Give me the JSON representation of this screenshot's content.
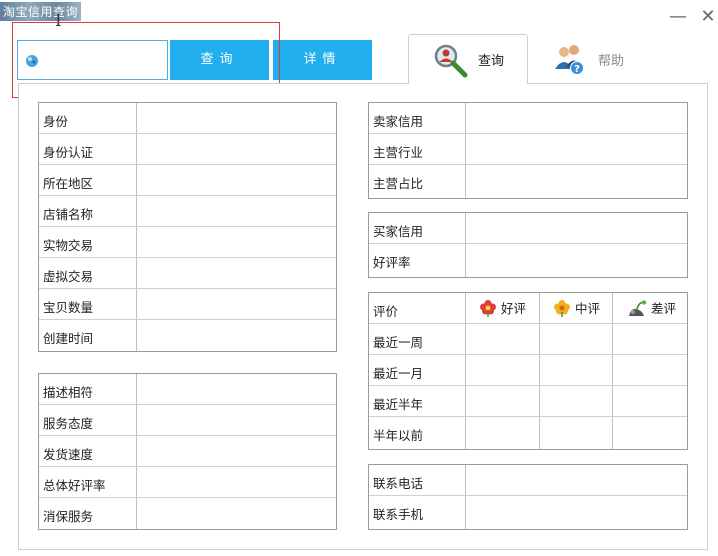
{
  "window": {
    "title": "淘宝信用查询",
    "min": "—",
    "close": "✕"
  },
  "search": {
    "value": "",
    "placeholder": ""
  },
  "buttons": {
    "query": "查询",
    "detail": "详情"
  },
  "tabs": [
    {
      "label": "查询",
      "icon": "magnifier-person-icon",
      "active": true
    },
    {
      "label": "帮助",
      "icon": "users-help-icon",
      "active": false
    }
  ],
  "info_group": {
    "rows": [
      "身份",
      "身份认证",
      "所在地区",
      "店铺名称",
      "实物交易",
      "虚拟交易",
      "宝贝数量",
      "创建时间"
    ]
  },
  "service_group": {
    "rows": [
      "描述相符",
      "服务态度",
      "发货速度",
      "总体好评率",
      "消保服务"
    ]
  },
  "seller_group": {
    "rows": [
      "卖家信用",
      "主营行业",
      "主营占比"
    ]
  },
  "buyer_group": {
    "rows": [
      "买家信用",
      "好评率"
    ]
  },
  "rating_group": {
    "header": {
      "label": "评价",
      "good": "好评",
      "neutral": "中评",
      "bad": "差评"
    },
    "rows": [
      "最近一周",
      "最近一月",
      "最近半年",
      "半年以前"
    ]
  },
  "contact_group": {
    "rows": [
      "联系电话",
      "联系手机"
    ]
  },
  "colors": {
    "accent": "#21aff0",
    "highlight": "#e03a3a",
    "border": "#9a9a9a"
  }
}
